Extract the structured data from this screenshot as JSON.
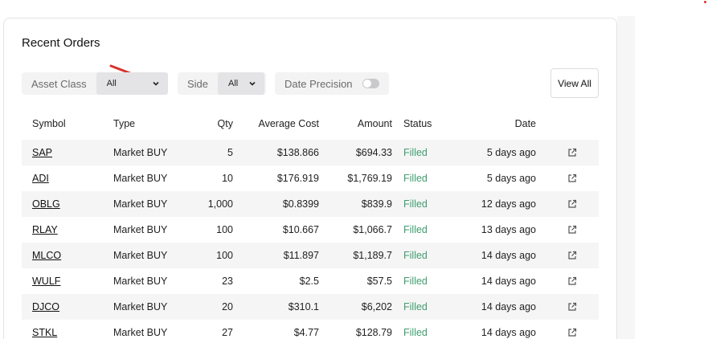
{
  "card": {
    "title": "Recent Orders",
    "view_all_label": "View All"
  },
  "filters": {
    "asset_class": {
      "label": "Asset Class",
      "value": "All"
    },
    "side": {
      "label": "Side",
      "value": "All"
    },
    "date_precision": {
      "label": "Date Precision",
      "enabled": false
    }
  },
  "table": {
    "headers": {
      "symbol": "Symbol",
      "type": "Type",
      "qty": "Qty",
      "avg_cost": "Average Cost",
      "amount": "Amount",
      "status": "Status",
      "date": "Date"
    },
    "rows": [
      {
        "symbol": "SAP",
        "type": "Market BUY",
        "qty": "5",
        "avg_cost": "$138.866",
        "amount": "$694.33",
        "status": "Filled",
        "date": "5 days ago"
      },
      {
        "symbol": "ADI",
        "type": "Market BUY",
        "qty": "10",
        "avg_cost": "$176.919",
        "amount": "$1,769.19",
        "status": "Filled",
        "date": "5 days ago"
      },
      {
        "symbol": "OBLG",
        "type": "Market BUY",
        "qty": "1,000",
        "avg_cost": "$0.8399",
        "amount": "$839.9",
        "status": "Filled",
        "date": "12 days ago"
      },
      {
        "symbol": "RLAY",
        "type": "Market BUY",
        "qty": "100",
        "avg_cost": "$10.667",
        "amount": "$1,066.7",
        "status": "Filled",
        "date": "13 days ago"
      },
      {
        "symbol": "MLCO",
        "type": "Market BUY",
        "qty": "100",
        "avg_cost": "$11.897",
        "amount": "$1,189.7",
        "status": "Filled",
        "date": "14 days ago"
      },
      {
        "symbol": "WULF",
        "type": "Market BUY",
        "qty": "23",
        "avg_cost": "$2.5",
        "amount": "$57.5",
        "status": "Filled",
        "date": "14 days ago"
      },
      {
        "symbol": "DJCO",
        "type": "Market BUY",
        "qty": "20",
        "avg_cost": "$310.1",
        "amount": "$6,202",
        "status": "Filled",
        "date": "14 days ago"
      },
      {
        "symbol": "STKL",
        "type": "Market BUY",
        "qty": "27",
        "avg_cost": "$4.77",
        "amount": "$128.79",
        "status": "Filled",
        "date": "14 days ago"
      }
    ]
  },
  "colors": {
    "status_filled": "#3f9e6f",
    "annotation_arrow": "#d9322b"
  },
  "icons": {
    "row_link": "external-link-icon",
    "dropdown": "chevron-down-icon"
  }
}
